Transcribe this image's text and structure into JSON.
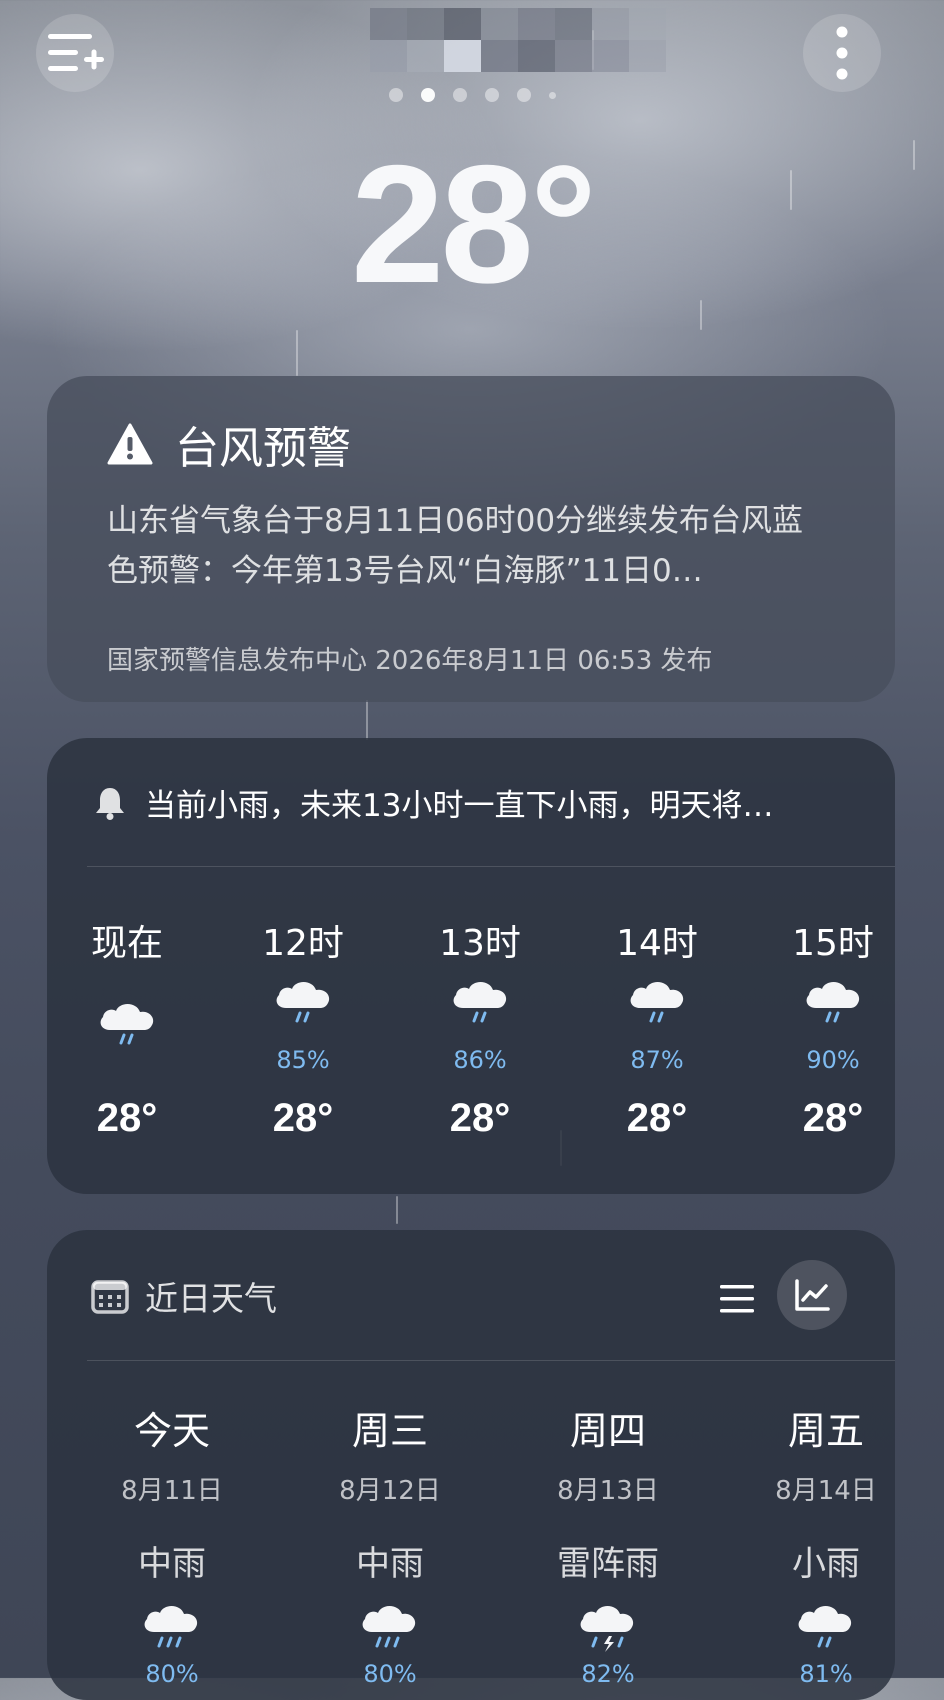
{
  "top": {
    "current_temp": "28°",
    "page_count": 6,
    "active_page": 1
  },
  "alert": {
    "title": "台风预警",
    "body": "山东省气象台于8月11日06时00分继续发布台风蓝色预警：今年第13号台风“白海豚”11日0…",
    "source": "国家预警信息发布中心 2026年8月11日 06:53 发布"
  },
  "hourly": {
    "summary": "当前小雨，未来13小时一直下小雨，明天将…",
    "items": [
      {
        "time": "现在",
        "pop": "",
        "temp": "28°",
        "icon": "light-rain-icon"
      },
      {
        "time": "12时",
        "pop": "85%",
        "temp": "28°",
        "icon": "light-rain-icon"
      },
      {
        "time": "13时",
        "pop": "86%",
        "temp": "28°",
        "icon": "light-rain-icon"
      },
      {
        "time": "14时",
        "pop": "87%",
        "temp": "28°",
        "icon": "light-rain-icon"
      },
      {
        "time": "15时",
        "pop": "90%",
        "temp": "28°",
        "icon": "light-rain-icon"
      }
    ]
  },
  "daily": {
    "title": "近日天气",
    "items": [
      {
        "day": "今天",
        "date": "8月11日",
        "condition": "中雨",
        "pop": "80%",
        "icon": "moderate-rain-icon"
      },
      {
        "day": "周三",
        "date": "8月12日",
        "condition": "中雨",
        "pop": "80%",
        "icon": "moderate-rain-icon"
      },
      {
        "day": "周四",
        "date": "8月13日",
        "condition": "雷阵雨",
        "pop": "82%",
        "icon": "thunderstorm-icon"
      },
      {
        "day": "周五",
        "date": "8月14日",
        "condition": "小雨",
        "pop": "81%",
        "icon": "light-rain-icon"
      }
    ]
  },
  "colors": {
    "precip_blue": "#7fbbf0",
    "card_bg": "#2c323f",
    "alert_card_bg": "#484e5c"
  }
}
